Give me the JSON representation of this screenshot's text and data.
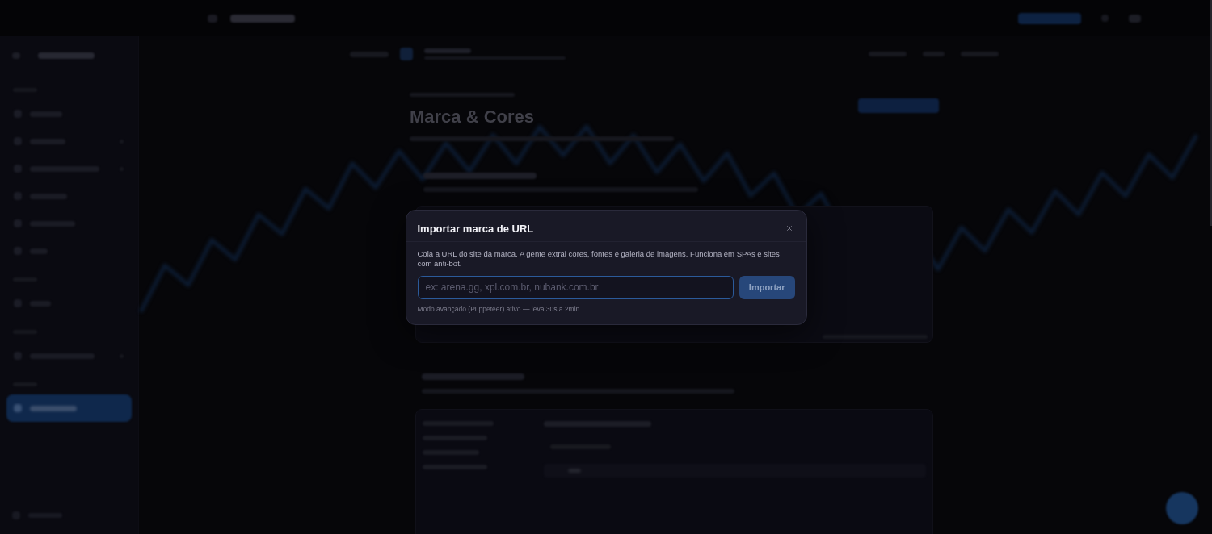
{
  "sidebar": {
    "items": [
      {
        "selected": false
      },
      {
        "selected": false
      },
      {
        "selected": false
      },
      {
        "selected": false
      },
      {
        "selected": false
      },
      {
        "selected": false
      },
      {
        "selected": false
      },
      {
        "selected": false
      },
      {
        "selected": true
      }
    ]
  },
  "page": {
    "title": "Marca & Cores"
  },
  "modal": {
    "title": "Importar marca de URL",
    "description": "Cola a URL do site da marca. A gente extrai cores, fontes e galeria de imagens. Funciona em SPAs e sites com anti-bot.",
    "url_field": {
      "placeholder": "ex: arena.gg, xpl.com.br, nubank.com.br"
    },
    "import_button": {
      "label": "Importar",
      "disabled": true
    },
    "hint": "Modo avançado (Puppeteer) ativo — leva 30s a 2min."
  }
}
